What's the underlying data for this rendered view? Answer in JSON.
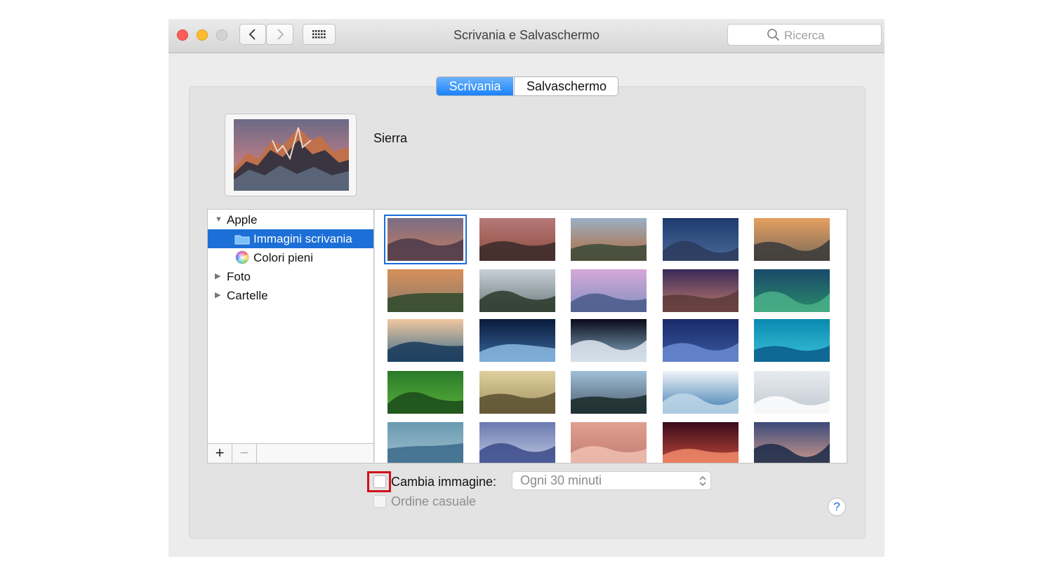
{
  "window": {
    "title": "Scrivania e Salvaschermo"
  },
  "search": {
    "placeholder": "Ricerca"
  },
  "tabs": [
    {
      "label": "Scrivania",
      "active": true
    },
    {
      "label": "Salvaschermo",
      "active": false
    }
  ],
  "current_picture": {
    "name": "Sierra"
  },
  "sidebar": {
    "items": [
      {
        "label": "Apple",
        "expanded": true
      },
      {
        "label": "Immagini scrivania",
        "selected": true,
        "icon": "folder-icon"
      },
      {
        "label": "Colori pieni",
        "icon": "color-wheel-icon"
      },
      {
        "label": "Foto",
        "expanded": false
      },
      {
        "label": "Cartelle",
        "expanded": false
      }
    ],
    "add_label": "+",
    "remove_label": "−"
  },
  "wallpapers": {
    "count": 25,
    "columns": 5,
    "selected_index": 0,
    "palettes": [
      [
        "#7a6e86",
        "#c67a5a",
        "#4a3a4a"
      ],
      [
        "#b77a7a",
        "#8a4a3a",
        "#3a2a2a"
      ],
      [
        "#9ab0c4",
        "#b06a3a",
        "#3a4a3a"
      ],
      [
        "#1e3a6e",
        "#4a6a9a",
        "#2a3a5a"
      ],
      [
        "#e6a060",
        "#7a6a5a",
        "#3a3a3a"
      ],
      [
        "#d7905a",
        "#8a7a6a",
        "#2e4a2a"
      ],
      [
        "#c8d0d8",
        "#6a7a7a",
        "#2a3a2a"
      ],
      [
        "#d6a8d8",
        "#8090c0",
        "#4a5a8a"
      ],
      [
        "#3a2a5a",
        "#c07a6a",
        "#5a3a3a"
      ],
      [
        "#1a4a6a",
        "#2a8a6a",
        "#4ab08a"
      ],
      [
        "#f0c8a0",
        "#3a6a8a",
        "#1a3a5a"
      ],
      [
        "#0a1a3a",
        "#3a6aa0",
        "#8ab8e0"
      ],
      [
        "#0a0a1a",
        "#8ab0c8",
        "#e0e8f0"
      ],
      [
        "#1a2a6a",
        "#3a5aa0",
        "#6a8ad0"
      ],
      [
        "#0a8ab0",
        "#3ac0d8",
        "#0a5a8a"
      ],
      [
        "#2a7a2a",
        "#5ab03a",
        "#1a4a1a"
      ],
      [
        "#e0d0a0",
        "#a09060",
        "#5a5030"
      ],
      [
        "#a0c0d8",
        "#4a5a6a",
        "#1a2a2a"
      ],
      [
        "#f0f4f8",
        "#3a7ab0",
        "#c0d8e8"
      ],
      [
        "#e8ecf0",
        "#c0c8d0",
        "#ffffff"
      ],
      [
        "#6a9ab0",
        "#a0c0d0",
        "#3a6a8a"
      ],
      [
        "#6a7ab0",
        "#c0c8e0",
        "#3a4a8a"
      ],
      [
        "#e0a090",
        "#c07a70",
        "#f0c0b0"
      ],
      [
        "#3a0a1a",
        "#c04a3a",
        "#f08a6a"
      ],
      [
        "#3a4a7a",
        "#d09a8a",
        "#1a2a4a"
      ]
    ]
  },
  "change_picture": {
    "label": "Cambia immagine:",
    "checked": false
  },
  "interval": {
    "value": "Ogni 30 minuti"
  },
  "random_order": {
    "label": "Ordine casuale",
    "checked": false,
    "enabled": false
  },
  "help": {
    "label": "?"
  },
  "colors": {
    "accent": "#1a6ed8",
    "highlight": "#d0121b"
  }
}
